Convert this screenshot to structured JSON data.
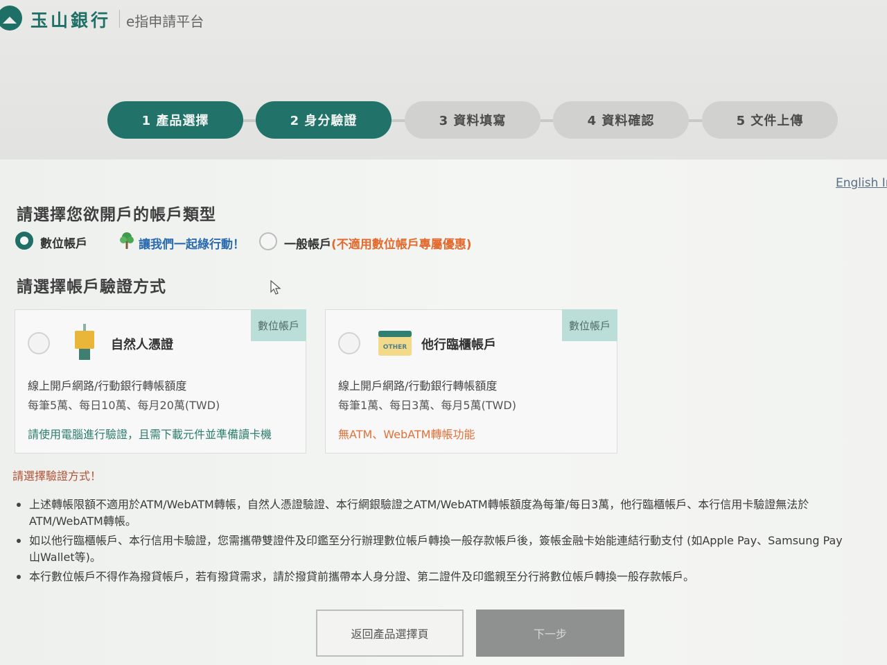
{
  "header": {
    "brand": "玉山銀行",
    "platform": "e指申請平台"
  },
  "steps": [
    {
      "label": "1 產品選擇",
      "state": "active"
    },
    {
      "label": "2 身分驗證",
      "state": "active"
    },
    {
      "label": "3 資料填寫",
      "state": "inactive"
    },
    {
      "label": "4 資料確認",
      "state": "inactive"
    },
    {
      "label": "5 文件上傳",
      "state": "inactive"
    }
  ],
  "language_link": "English Ir",
  "account_type": {
    "title": "請選擇您欲開戶的帳戶類型",
    "option_digital": "數位帳戶",
    "green_slogan": "讓我們一起綠行動！",
    "option_general": "一般帳戶",
    "general_note": "(不適用數位帳戶專屬優惠)"
  },
  "verify_method": {
    "title": "請選擇帳戶驗證方式",
    "cards": [
      {
        "tag": "數位帳戶",
        "title": "自然人憑證",
        "line1": "線上開戶網路/行動銀行轉帳額度",
        "line2": "每筆5萬、每日10萬、每月20萬(TWD)",
        "line3": "請使用電腦進行驗證，且需下載元件並準備讀卡機",
        "icon": "certificate-icon"
      },
      {
        "tag": "數位帳戶",
        "title": "他行臨櫃帳戶",
        "line1": "線上開戶網路/行動銀行轉帳額度",
        "line2": "每筆1萬、每日3萬、每月5萬(TWD)",
        "line3": "無ATM、WebATM轉帳功能",
        "icon": "other-bank-icon",
        "icon_text": "OTHER"
      }
    ]
  },
  "warning": "請選擇驗證方式！",
  "notes": [
    {
      "line1": "上述轉帳限額不適用於ATM/WebATM轉帳，自然人憑證驗證、本行網銀驗證之ATM/WebATM轉帳額度為每筆/每日3萬，他行臨櫃帳戶、本行信用卡驗證無法於",
      "line2": "ATM/WebATM轉帳。"
    },
    {
      "line1": "如以他行臨櫃帳戶、本行信用卡驗證，您需攜帶雙證件及印鑑至分行辦理數位帳戶轉換一般存款帳戶後，簽帳金融卡始能連結行動支付 (如Apple Pay、Samsung Pay",
      "line2": "山Wallet等)。"
    },
    {
      "line1": "本行數位帳戶不得作為撥貸帳戶，若有撥貸需求，請於撥貸前攜帶本人身分證、第二證件及印鑑親至分行將數位帳戶轉換一般存款帳戶。",
      "line2": ""
    }
  ],
  "buttons": {
    "back": "返回產品選擇頁",
    "next": "下一步"
  },
  "colors": {
    "brand_green": "#217369",
    "step_inactive": "#d1d1cf",
    "tag_bg": "#bcded8",
    "warning": "#e26a2e"
  }
}
